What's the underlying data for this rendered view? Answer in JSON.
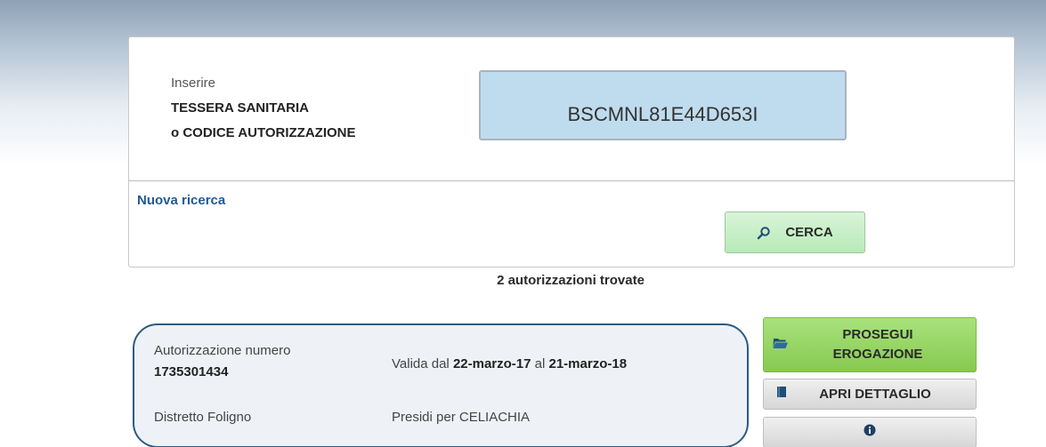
{
  "search": {
    "prompt_line1": "Inserire",
    "prompt_line2": "TESSERA SANITARIA",
    "prompt_line3": "o CODICE AUTORIZZAZIONE",
    "input_value": "BSCMNL81E44D653I",
    "new_search_label": "Nuova ricerca",
    "search_button_label": "CERCA",
    "search_icon": "search-icon"
  },
  "results": {
    "count_text": "2 autorizzazioni trovate"
  },
  "authorization": {
    "number_label": "Autorizzazione numero",
    "number": "1735301434",
    "validity_prefix": "Valida dal ",
    "valid_from": "22-marzo-17",
    "validity_mid": " al ",
    "valid_to": "21-marzo-18",
    "district": "Distretto Foligno",
    "category": "Presidi per CELIACHIA"
  },
  "actions": {
    "proceed_line1": "PROSEGUI",
    "proceed_line2": "EROGAZIONE",
    "proceed_icon": "folder-open-icon",
    "detail_label": "APRI DETTAGLIO",
    "detail_icon": "book-icon",
    "info_icon": "info-icon"
  },
  "colors": {
    "accent_blue": "#1f5a97",
    "input_bg": "#bfdcee",
    "card_border": "#2d5b82",
    "proceed_green": "#86c94f",
    "search_green": "#b8eab8"
  }
}
